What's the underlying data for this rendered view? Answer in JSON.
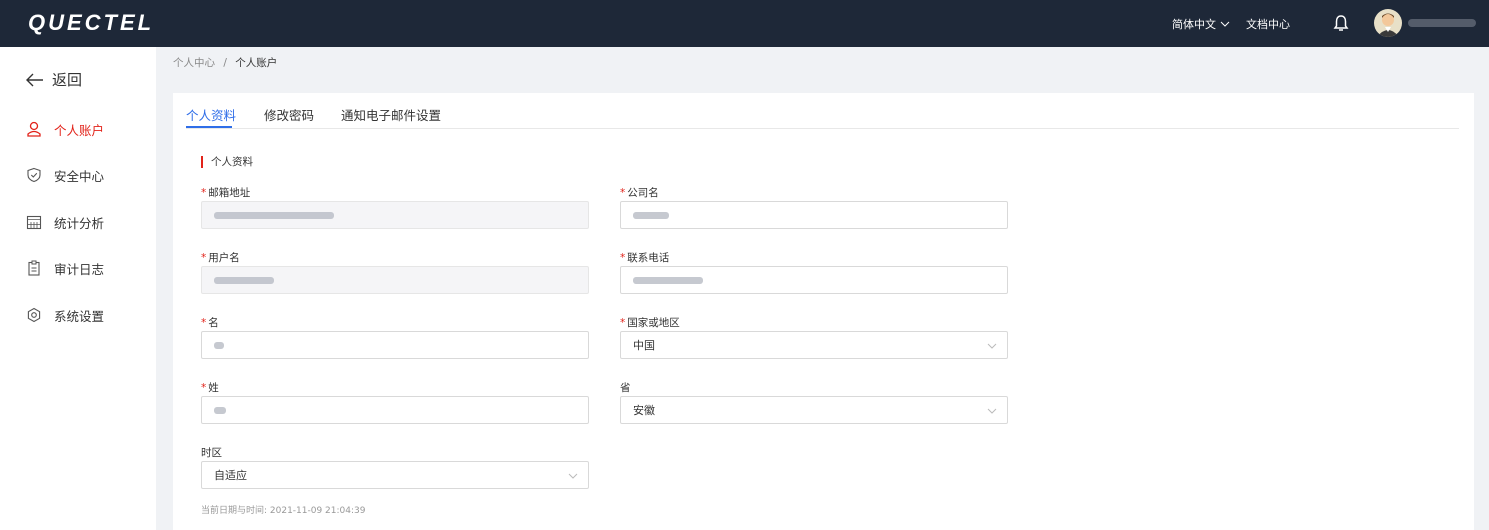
{
  "header": {
    "logo_text": "QUECTEL",
    "language": "简体中文",
    "docs": "文档中心"
  },
  "sidebar": {
    "back": "返回",
    "items": [
      {
        "label": "个人账户",
        "icon": "user-icon",
        "active": true
      },
      {
        "label": "安全中心",
        "icon": "shield-check-icon",
        "active": false
      },
      {
        "label": "统计分析",
        "icon": "calendar-grid-icon",
        "active": false
      },
      {
        "label": "审计日志",
        "icon": "clipboard-icon",
        "active": false
      },
      {
        "label": "系统设置",
        "icon": "gear-icon",
        "active": false
      }
    ]
  },
  "breadcrumb": {
    "parent": "个人中心",
    "separator": "/",
    "current": "个人账户"
  },
  "tabs": [
    "个人资料",
    "修改密码",
    "通知电子邮件设置"
  ],
  "section_title": "个人资料",
  "form": {
    "email_label": "邮箱地址",
    "username_label": "用户名",
    "first_name_label": "名",
    "last_name_label": "姓",
    "timezone_label": "时区",
    "timezone_value": "自适应",
    "company_label": "公司名",
    "phone_label": "联系电话",
    "country_label": "国家或地区",
    "country_value": "中国",
    "province_label": "省",
    "province_value": "安徽",
    "current_time_hint": "当前日期与时间: 2021-11-09 21:04:39"
  },
  "colors": {
    "accent": "#2f6ee8",
    "brand_red": "#e2231a",
    "topbar": "#1e2838"
  }
}
